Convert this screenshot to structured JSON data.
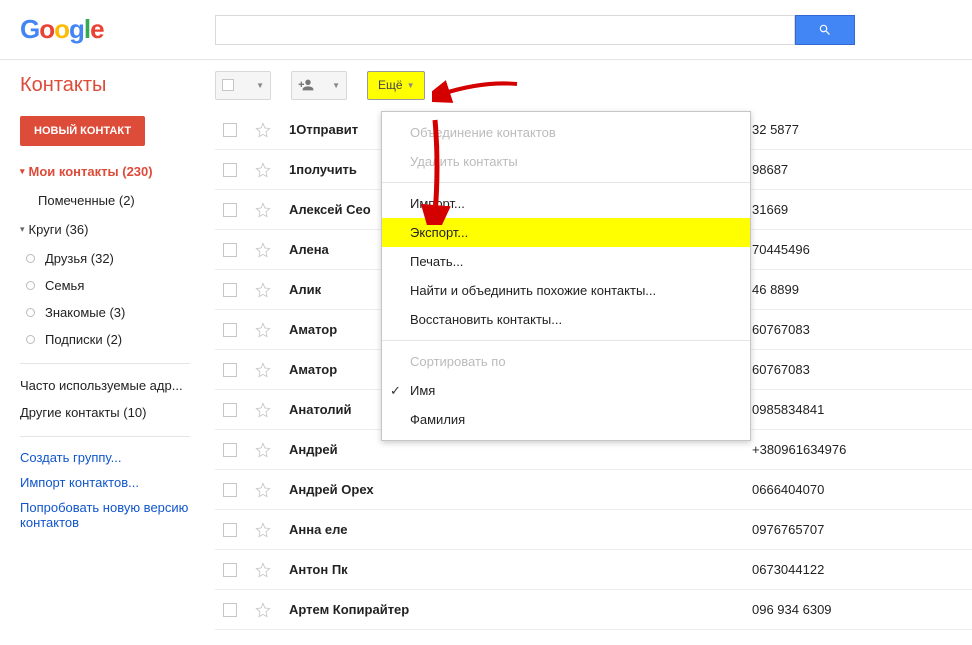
{
  "logo_chars": [
    "G",
    "o",
    "o",
    "g",
    "l",
    "e"
  ],
  "header": {
    "search_placeholder": ""
  },
  "app_title": "Контакты",
  "toolbar": {
    "more_label": "Ещё"
  },
  "sidebar": {
    "new_contact": "НОВЫЙ КОНТАКТ",
    "my_contacts": {
      "label": "Мои контакты",
      "count": "(230)"
    },
    "starred": {
      "label": "Помеченные",
      "count": "(2)"
    },
    "circles": {
      "label": "Круги",
      "count": "(36)"
    },
    "circle_items": [
      {
        "label": "Друзья",
        "count": "(32)"
      },
      {
        "label": "Семья",
        "count": ""
      },
      {
        "label": "Знакомые",
        "count": "(3)"
      },
      {
        "label": "Подписки",
        "count": "(2)"
      }
    ],
    "frequent": "Часто используемые адр...",
    "other": {
      "label": "Другие контакты",
      "count": "(10)"
    },
    "links": [
      "Создать группу...",
      "Импорт контактов...",
      "Попробовать новую версию контактов"
    ]
  },
  "dropdown": {
    "merge": "Объединение контактов",
    "delete": "Удалить контакты",
    "import": "Импорт...",
    "export": "Экспорт...",
    "print": "Печать...",
    "find_merge": "Найти и объединить похожие контакты...",
    "restore": "Восстановить контакты...",
    "sort_by": "Сортировать по",
    "first_name": "Имя",
    "last_name": "Фамилия"
  },
  "contacts": [
    {
      "name": "1Отправит",
      "phone": "32 5877"
    },
    {
      "name": "1получить",
      "phone": "98687"
    },
    {
      "name": "Алексей Сео",
      "phone": "31669"
    },
    {
      "name": "Алена",
      "phone": "70445496"
    },
    {
      "name": "Алик",
      "phone": "46 8899"
    },
    {
      "name": "Аматор",
      "phone": "60767083"
    },
    {
      "name": "Аматор",
      "phone": "60767083"
    },
    {
      "name": "Анатолий",
      "phone": "0985834841"
    },
    {
      "name": "Андрей",
      "phone": "+380961634976"
    },
    {
      "name": "Андрей Орех",
      "phone": "0666404070"
    },
    {
      "name": "Анна еле",
      "phone": "0976765707"
    },
    {
      "name": "Антон Пк",
      "phone": "0673044122"
    },
    {
      "name": "Артем Копирайтер",
      "phone": "096 934 6309"
    }
  ]
}
